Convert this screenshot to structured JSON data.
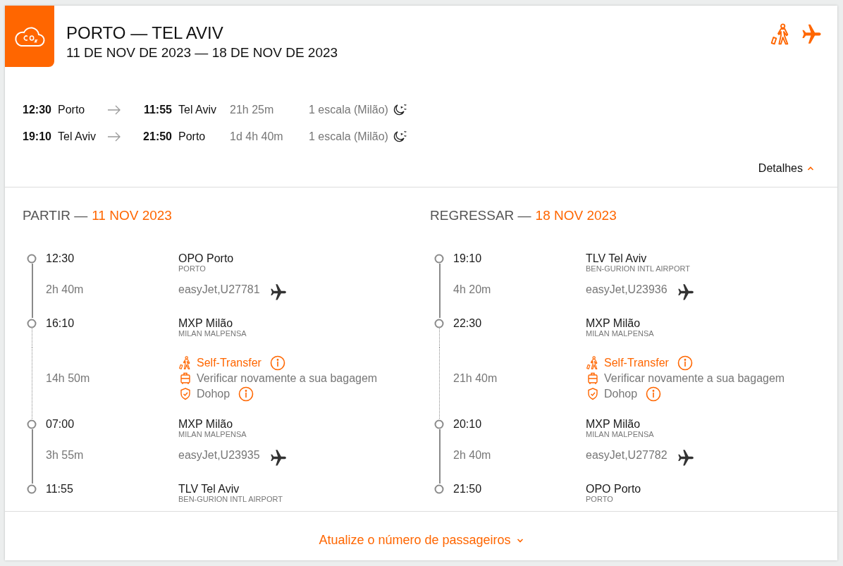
{
  "header": {
    "title": "PORTO — TEL AVIV",
    "dates": "11 DE NOV DE 2023 — 18 DE NOV DE 2023"
  },
  "summary": [
    {
      "dep_time": "12:30",
      "dep_city": "Porto",
      "arr_time": "11:55",
      "arr_city": "Tel Aviv",
      "duration": "21h 25m",
      "stops": "1 escala (Milão)",
      "overnight": true
    },
    {
      "dep_time": "19:10",
      "dep_city": "Tel Aviv",
      "arr_time": "21:50",
      "arr_city": "Porto",
      "duration": "1d 4h 40m",
      "stops": "1 escala (Milão)",
      "overnight": true
    }
  ],
  "details_toggle": {
    "label": "Detalhes",
    "expanded": true
  },
  "legs": [
    {
      "heading": "PARTIR —",
      "date": "11 NOV 2023",
      "items": [
        {
          "kind": "stop",
          "time": "12:30",
          "airport": "OPO Porto",
          "airport_name": "PORTO"
        },
        {
          "kind": "flight",
          "duration": "2h 40m",
          "carrier": "easyJet,U27781"
        },
        {
          "kind": "stop",
          "time": "16:10",
          "airport": "MXP Milão",
          "airport_name": "MILAN MALPENSA"
        },
        {
          "kind": "layover",
          "duration": "14h 50m",
          "transfer": "Self-Transfer",
          "baggage": "Verificar novamente a sua bagagem",
          "protection": "Dohop"
        },
        {
          "kind": "stop",
          "time": "07:00",
          "airport": "MXP Milão",
          "airport_name": "MILAN MALPENSA"
        },
        {
          "kind": "flight",
          "duration": "3h 55m",
          "carrier": "easyJet,U23935"
        },
        {
          "kind": "stop",
          "time": "11:55",
          "airport": "TLV Tel Aviv",
          "airport_name": "BEN-GURION INTL AIRPORT"
        }
      ]
    },
    {
      "heading": "REGRESSAR —",
      "date": "18 NOV 2023",
      "items": [
        {
          "kind": "stop",
          "time": "19:10",
          "airport": "TLV Tel Aviv",
          "airport_name": "BEN-GURION INTL AIRPORT"
        },
        {
          "kind": "flight",
          "duration": "4h 20m",
          "carrier": "easyJet,U23936"
        },
        {
          "kind": "stop",
          "time": "22:30",
          "airport": "MXP Milão",
          "airport_name": "MILAN MALPENSA"
        },
        {
          "kind": "layover",
          "duration": "21h 40m",
          "transfer": "Self-Transfer",
          "baggage": "Verificar novamente a sua bagagem",
          "protection": "Dohop"
        },
        {
          "kind": "stop",
          "time": "20:10",
          "airport": "MXP Milão",
          "airport_name": "MILAN MALPENSA"
        },
        {
          "kind": "flight",
          "duration": "2h 40m",
          "carrier": "easyJet,U27782"
        },
        {
          "kind": "stop",
          "time": "21:50",
          "airport": "OPO Porto",
          "airport_name": "PORTO"
        }
      ]
    }
  ],
  "footer": {
    "link": "Atualize o número de passageiros"
  }
}
